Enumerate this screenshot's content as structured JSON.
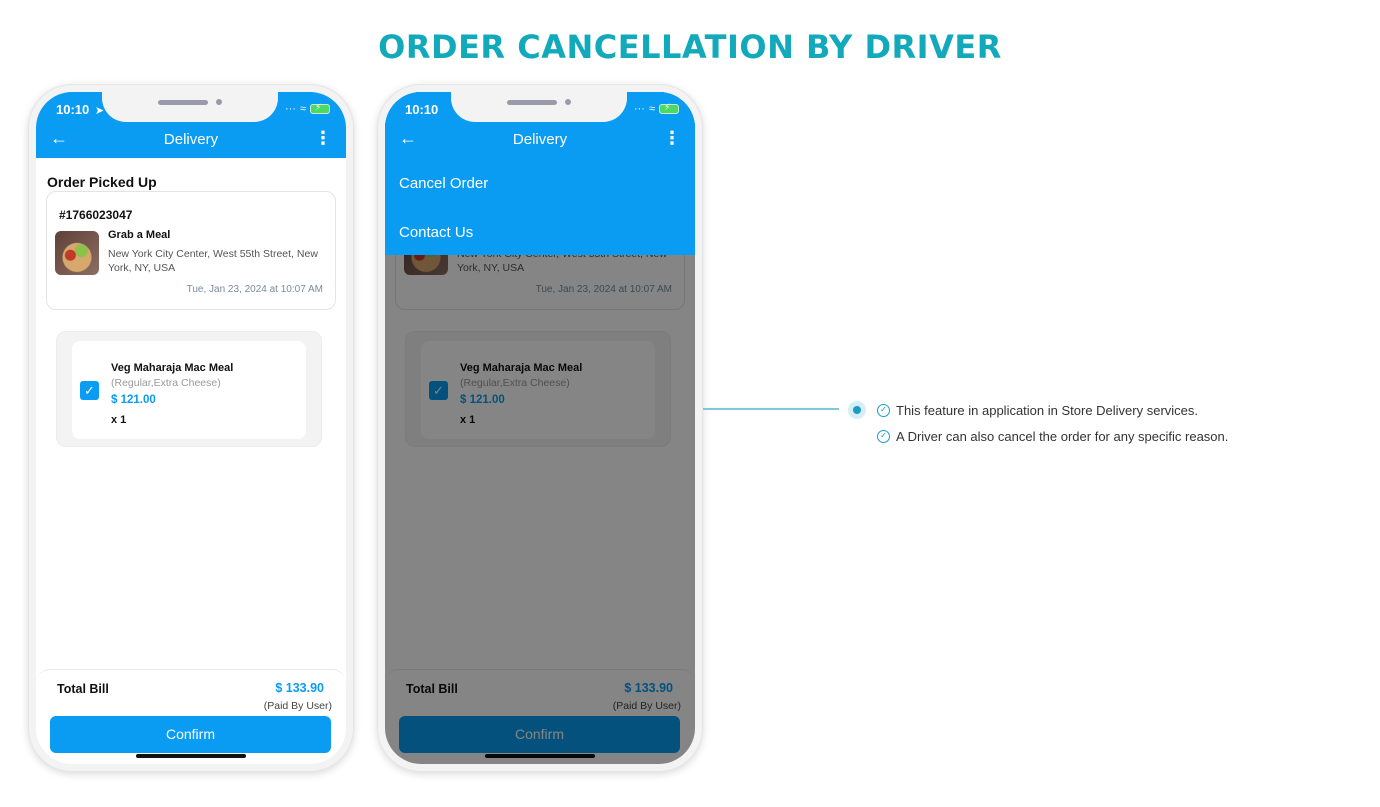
{
  "page": {
    "title": "ORDER CANCELLATION BY DRIVER"
  },
  "colors": {
    "brand_blue": "#0a9bf2",
    "title_teal": "#12a9bb",
    "accent_teal": "#1a9cc4"
  },
  "phone": {
    "status_time": "10:10",
    "app_title": "Delivery",
    "section_title": "Order Picked Up",
    "order": {
      "id": "#1766023047",
      "store_name": "Grab a Meal",
      "store_address": "New York City Center, West 55th Street, New York, NY, USA",
      "date": "Tue, Jan 23, 2024 at 10:07 AM"
    },
    "item": {
      "name": "Veg Maharaja Mac Meal",
      "options": "(Regular,Extra Cheese)",
      "price": "$ 121.00",
      "quantity": "x 1",
      "checked": true
    },
    "footer": {
      "total_label": "Total Bill",
      "total_value": "$ 133.90",
      "paid_by": "(Paid By User)",
      "confirm_label": "Confirm"
    }
  },
  "menu": {
    "items": [
      {
        "label": "Cancel Order"
      },
      {
        "label": "Contact Us"
      }
    ]
  },
  "icons": {
    "back": "←",
    "kebab": "⋮",
    "location": "➤",
    "wifi": "◔",
    "check": "✓"
  },
  "features": [
    {
      "text": "This feature in application in Store Delivery services."
    },
    {
      "text": "A Driver can also cancel the order for any specific reason."
    }
  ]
}
